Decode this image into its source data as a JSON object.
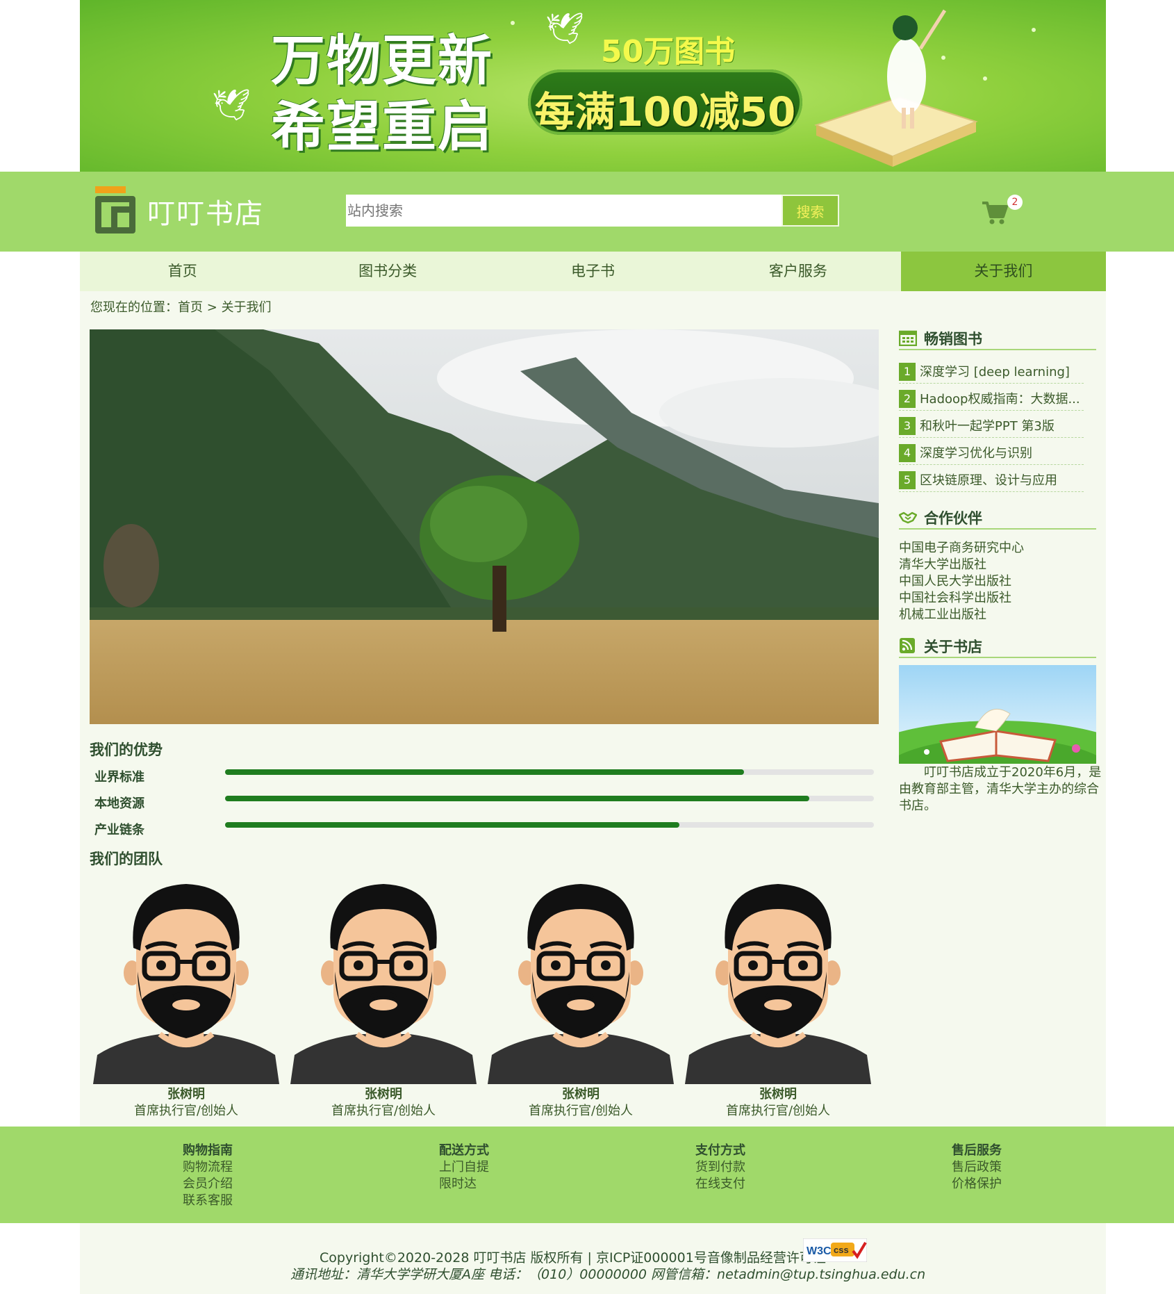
{
  "banner": {
    "headline_1": "万物更新",
    "headline_2": "希望重启",
    "books_text": "50万图书",
    "promo_text": "每满100减50"
  },
  "header": {
    "site_title": "叮叮书店",
    "search_placeholder": "站内搜索",
    "search_button": "搜索",
    "cart_count": "2"
  },
  "nav": {
    "items": [
      {
        "label": "首页",
        "active": false
      },
      {
        "label": "图书分类",
        "active": false
      },
      {
        "label": "电子书",
        "active": false
      },
      {
        "label": "客户服务",
        "active": false
      },
      {
        "label": "关于我们",
        "active": true
      }
    ]
  },
  "breadcrumb": {
    "prefix": "您现在的位置：",
    "home": "首页",
    "separator": ">",
    "current": "关于我们"
  },
  "advantages": {
    "title": "我们的优势",
    "items": [
      {
        "label": "业界标准",
        "percent": 80
      },
      {
        "label": "本地资源",
        "percent": 90
      },
      {
        "label": "产业链条",
        "percent": 70
      }
    ]
  },
  "team": {
    "title": "我们的团队",
    "members": [
      {
        "name": "张树明",
        "role": "首席执行官/创始人"
      },
      {
        "name": "张树明",
        "role": "首席执行官/创始人"
      },
      {
        "name": "张树明",
        "role": "首席执行官/创始人"
      },
      {
        "name": "张树明",
        "role": "首席执行官/创始人"
      }
    ]
  },
  "sidebar": {
    "bestsellers_title": "畅销图书",
    "bestsellers": [
      {
        "rank": "1",
        "title": "深度学习 [deep learning]"
      },
      {
        "rank": "2",
        "title": "Hadoop权威指南：大数据..."
      },
      {
        "rank": "3",
        "title": "和秋叶一起学PPT 第3版"
      },
      {
        "rank": "4",
        "title": "深度学习优化与识别"
      },
      {
        "rank": "5",
        "title": "区块链原理、设计与应用"
      }
    ],
    "partners_title": "合作伙伴",
    "partners": [
      "中国电子商务研究中心",
      "清华大学出版社",
      "中国人民大学出版社",
      "中国社会科学出版社",
      "机械工业出版社"
    ],
    "about_title": "关于书店",
    "about_text": "叮叮书店成立于2020年6月，是由教育部主管，清华大学主办的综合书店。"
  },
  "footer": {
    "columns": [
      {
        "title": "购物指南",
        "links": [
          "购物流程",
          "会员介绍",
          "联系客服"
        ]
      },
      {
        "title": "配送方式",
        "links": [
          "上门自提",
          "限时达"
        ]
      },
      {
        "title": "支付方式",
        "links": [
          "货到付款",
          "在线支付"
        ]
      },
      {
        "title": "售后服务",
        "links": [
          "售后政策",
          "价格保护"
        ]
      }
    ],
    "copyright": "Copyright©2020-2028 叮叮书店 版权所有 | 京ICP证000001号音像制品经营许可证",
    "address": "通讯地址：清华大学学研大厦A座  电话：（010）00000000  网管信箱：netadmin@tup.tsinghua.edu.cn",
    "badge_w3c": "W3C",
    "badge_css": "css"
  },
  "colors": {
    "header_green": "#a0d96a",
    "nav_active": "#8cc63f",
    "progress_fill": "#1f7d1f",
    "content_bg": "#f5f9ee"
  }
}
